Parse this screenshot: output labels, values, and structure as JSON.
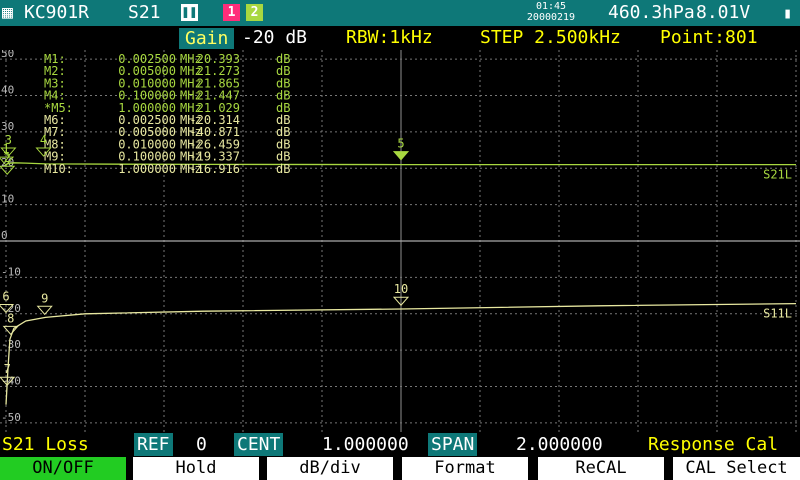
{
  "title_bar": {
    "device": "KC901R",
    "mode": "S21",
    "channel_1": "1",
    "channel_2": "2",
    "time": "01:45",
    "date": "20000219",
    "pressure": "460.3hPa",
    "voltage": "8.01V",
    "colors": {
      "bar": "#0e7878",
      "channel_1": "#ff2d7a",
      "channel_2": "#a8d840"
    }
  },
  "info_bar": {
    "gain_label": "Gain",
    "gain_value": "-20 dB",
    "rbw": "RBW:1kHz",
    "step": "STEP 2.500kHz",
    "points": "Point:801"
  },
  "chart_data": {
    "type": "line",
    "y_ticks": [
      50,
      40,
      30,
      20,
      10,
      0,
      -10,
      -20,
      -30,
      -40,
      -50
    ],
    "ylim": [
      -52.5,
      52.5
    ],
    "x_range_mhz": [
      0,
      2
    ],
    "grid": true,
    "series": [
      {
        "name": "S21L",
        "color": "#a8d840",
        "x": [
          0.0,
          0.005,
          0.02,
          0.05,
          0.1,
          0.3,
          0.5,
          1.0,
          1.5,
          2.0
        ],
        "y": [
          21.0,
          21.3,
          21.5,
          21.4,
          21.2,
          21.1,
          21.05,
          21.0,
          21.0,
          21.0
        ]
      },
      {
        "name": "S11L",
        "color": "#e8e8a0",
        "x": [
          0.0,
          0.005,
          0.01,
          0.02,
          0.05,
          0.1,
          0.2,
          0.5,
          1.0,
          1.5,
          2.0
        ],
        "y": [
          -45.0,
          -35.0,
          -27.0,
          -24.0,
          -22.0,
          -21.0,
          -20.0,
          -19.3,
          -18.7,
          -17.8,
          -17.2
        ]
      }
    ],
    "markers": [
      {
        "label": "M1:",
        "freq": "0.002500",
        "unit": "MHz",
        "value": "20.393",
        "db": "dB",
        "color": "#a8d840"
      },
      {
        "label": "M2:",
        "freq": "0.005000",
        "unit": "MHz",
        "value": "21.273",
        "db": "dB",
        "color": "#a8d840"
      },
      {
        "label": "M3:",
        "freq": "0.010000",
        "unit": "MHz",
        "value": "21.865",
        "db": "dB",
        "color": "#a8d840"
      },
      {
        "label": "M4:",
        "freq": "0.100000",
        "unit": "MHz",
        "value": "21.447",
        "db": "dB",
        "color": "#a8d840"
      },
      {
        "label": "*M5:",
        "freq": "1.000000",
        "unit": "MHz",
        "value": "21.029",
        "db": "dB",
        "color": "#a8d840"
      },
      {
        "label": "M6:",
        "freq": "0.002500",
        "unit": "MHz",
        "value": "-20.314",
        "db": "dB",
        "color": "#e8e8a0"
      },
      {
        "label": "M7:",
        "freq": "0.005000",
        "unit": "MHz",
        "value": "-40.871",
        "db": "dB",
        "color": "#e8e8a0"
      },
      {
        "label": "M8:",
        "freq": "0.010000",
        "unit": "MHz",
        "value": "-26.459",
        "db": "dB",
        "color": "#e8e8a0"
      },
      {
        "label": "M9:",
        "freq": "0.100000",
        "unit": "MHz",
        "value": "-19.337",
        "db": "dB",
        "color": "#e8e8a0"
      },
      {
        "label": "M10:",
        "freq": "1.000000",
        "unit": "MHz",
        "value": "-16.916",
        "db": "dB",
        "color": "#e8e8a0"
      }
    ],
    "marker_flags": [
      {
        "n": "1",
        "x": 0.0,
        "y": 22.5,
        "color": "#a8d840",
        "filled": false
      },
      {
        "n": "2",
        "x": 0.003,
        "y": 20.0,
        "color": "#a8d840",
        "filled": false
      },
      {
        "n": "3",
        "x": 0.006,
        "y": 25.0,
        "color": "#a8d840",
        "filled": false
      },
      {
        "n": "4",
        "x": 0.095,
        "y": 25.0,
        "color": "#a8d840",
        "filled": false
      },
      {
        "n": "5",
        "x": 1.0,
        "y": 24.0,
        "color": "#a8d840",
        "filled": true
      },
      {
        "n": "6",
        "x": 0.0,
        "y": -18.0,
        "color": "#e8e8a0",
        "filled": false
      },
      {
        "n": "7",
        "x": 0.003,
        "y": -38.0,
        "color": "#e8e8a0",
        "filled": false
      },
      {
        "n": "8",
        "x": 0.012,
        "y": -24.0,
        "color": "#e8e8a0",
        "filled": false
      },
      {
        "n": "9",
        "x": 0.098,
        "y": -18.5,
        "color": "#e8e8a0",
        "filled": false
      },
      {
        "n": "10",
        "x": 1.0,
        "y": -16.0,
        "color": "#e8e8a0",
        "filled": false
      }
    ]
  },
  "status_bar": {
    "mode_label": "S21 Loss",
    "ref_label": "REF",
    "ref_value": "0",
    "cent_label": "CENT",
    "cent_value": "1.000000",
    "span_label": "SPAN",
    "span_value": "2.000000",
    "cal_status": "Response Cal"
  },
  "softkeys": {
    "on_off": "ON/OFF",
    "hold": "Hold",
    "db_div": "dB/div",
    "format": "Format",
    "recal": "ReCAL",
    "cal_select": "CAL Select",
    "active_color": "#22cc22"
  }
}
